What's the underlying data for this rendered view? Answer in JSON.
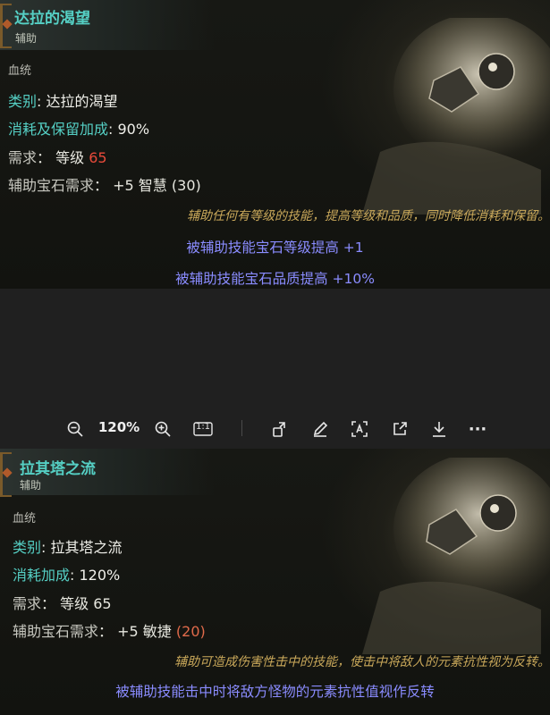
{
  "card1": {
    "name": "达拉的渴望",
    "type": "辅助",
    "tag": "血统",
    "category_key": "类别",
    "category_value": "达拉的渴望",
    "cost_key": "消耗及保留加成",
    "cost_value": "90%",
    "req_key": "需求",
    "req_level_label": "等级",
    "req_level_value": "65",
    "gem_req_key": "辅助宝石需求",
    "gem_req_value": "+5 智慧",
    "gem_req_paren": "(30)",
    "description": "辅助任何有等级的技能，提高等级和品质，同时降低消耗和保留。",
    "mods": [
      "被辅助技能宝石等级提高 +1",
      "被辅助技能宝石品质提高 +10%"
    ]
  },
  "toolbar": {
    "zoom": "120%",
    "icons": [
      "zoom-out-icon",
      "zoom-in-icon",
      "actual-size-icon",
      "rotate-icon",
      "edit-icon",
      "text-extract-icon",
      "share-icon",
      "download-icon",
      "more-icon"
    ],
    "actual_size_label": "1:1",
    "more_label": "···"
  },
  "card2": {
    "name": "拉其塔之流",
    "type": "辅助",
    "tag": "血统",
    "category_key": "类别",
    "category_value": "拉其塔之流",
    "cost_key": "消耗加成",
    "cost_value": "120%",
    "req_key": "需求",
    "req_level_label": "等级",
    "req_level_value": "65",
    "gem_req_key": "辅助宝石需求",
    "gem_req_value": "+5 敏捷",
    "gem_req_paren": "(20)",
    "description": "辅助可造成伤害性击中的技能，使击中将敌人的元素抗性视为反转。",
    "mods": [
      "被辅助技能击中时将敌方怪物的元素抗性值视作反转"
    ]
  },
  "colors": {
    "gem_name": "#55cfc4",
    "mod_text": "#8a8cff",
    "description": "#c9a85a",
    "requirement_red": "#e84a3a",
    "background": "#202020"
  }
}
